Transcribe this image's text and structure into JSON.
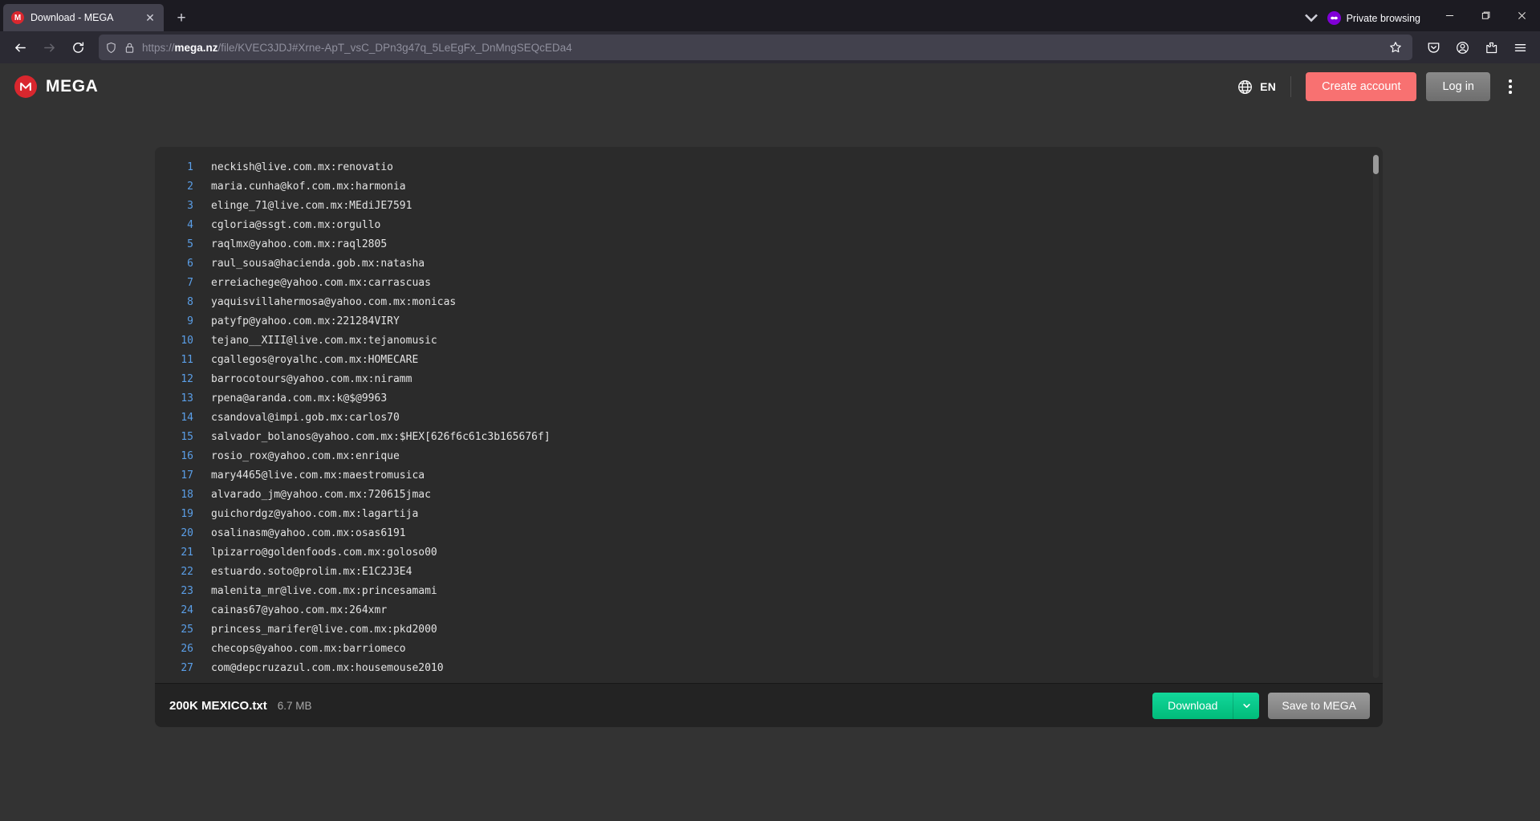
{
  "browser": {
    "tab": {
      "title": "Download - MEGA",
      "favicon_letter": "M",
      "close_label": "✕"
    },
    "new_tab_label": "+",
    "private_browsing_label": "Private browsing",
    "url": {
      "scheme": "https://",
      "host_bold": "mega.nz",
      "path": "/file/KVEC3JDJ#Xrne-ApT_vsC_DPn3g47q_5LeEgFx_DnMngSEQcEDa4",
      "full": "https://mega.nz/file/KVEC3JDJ#Xrne-ApT_vsC_DPn3g47q_5LeEgFx_DnMngSEQcEDa4"
    }
  },
  "mega": {
    "wordmark": "MEGA",
    "logo_letter": "M",
    "language_code": "EN",
    "create_account_label": "Create account",
    "log_in_label": "Log in",
    "accent_red": "#d9272e",
    "accent_coral": "#f87171",
    "accent_green": "#01bb7a"
  },
  "file": {
    "name": "200K MEXICO.txt",
    "size": "6.7 MB",
    "download_label": "Download",
    "save_to_mega_label": "Save to MEGA"
  },
  "viewer": {
    "lines": [
      {
        "n": "1",
        "text": "neckish@live.com.mx:renovatio"
      },
      {
        "n": "2",
        "text": "maria.cunha@kof.com.mx:harmonia"
      },
      {
        "n": "3",
        "text": "elinge_71@live.com.mx:MEdiJE7591"
      },
      {
        "n": "4",
        "text": "cgloria@ssgt.com.mx:orgullo"
      },
      {
        "n": "5",
        "text": "raqlmx@yahoo.com.mx:raql2805"
      },
      {
        "n": "6",
        "text": "raul_sousa@hacienda.gob.mx:natasha"
      },
      {
        "n": "7",
        "text": "erreiachege@yahoo.com.mx:carrascuas"
      },
      {
        "n": "8",
        "text": "yaquisvillahermosa@yahoo.com.mx:monicas"
      },
      {
        "n": "9",
        "text": "patyfp@yahoo.com.mx:221284VIRY"
      },
      {
        "n": "10",
        "text": "tejano__XIII@live.com.mx:tejanomusic"
      },
      {
        "n": "11",
        "text": "cgallegos@royalhc.com.mx:HOMECARE"
      },
      {
        "n": "12",
        "text": "barrocotours@yahoo.com.mx:niramm"
      },
      {
        "n": "13",
        "text": "rpena@aranda.com.mx:k@$@9963"
      },
      {
        "n": "14",
        "text": "csandoval@impi.gob.mx:carlos70"
      },
      {
        "n": "15",
        "text": "salvador_bolanos@yahoo.com.mx:$HEX[626f6c61c3b165676f]"
      },
      {
        "n": "16",
        "text": "rosio_rox@yahoo.com.mx:enrique"
      },
      {
        "n": "17",
        "text": "mary4465@live.com.mx:maestromusica"
      },
      {
        "n": "18",
        "text": "alvarado_jm@yahoo.com.mx:720615jmac"
      },
      {
        "n": "19",
        "text": "guichordgz@yahoo.com.mx:lagartija"
      },
      {
        "n": "20",
        "text": "osalinasm@yahoo.com.mx:osas6191"
      },
      {
        "n": "21",
        "text": "lpizarro@goldenfoods.com.mx:goloso00"
      },
      {
        "n": "22",
        "text": "estuardo.soto@prolim.mx:E1C2J3E4"
      },
      {
        "n": "23",
        "text": "malenita_mr@live.com.mx:princesamami"
      },
      {
        "n": "24",
        "text": "cainas67@yahoo.com.mx:264xmr"
      },
      {
        "n": "25",
        "text": "princess_marifer@live.com.mx:pkd2000"
      },
      {
        "n": "26",
        "text": "checops@yahoo.com.mx:barriomeco"
      },
      {
        "n": "27",
        "text": "com@depcruzazul.com.mx:housemouse2010"
      }
    ]
  }
}
